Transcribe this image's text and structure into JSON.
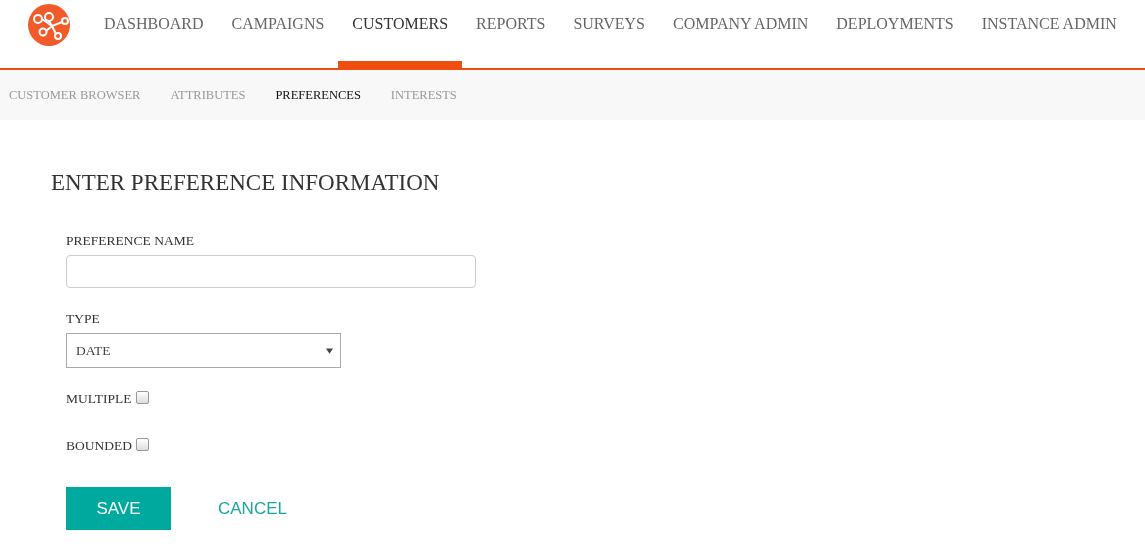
{
  "nav": [
    {
      "label": "DASHBOARD",
      "selected": false
    },
    {
      "label": "CAMPAIGNS",
      "selected": false
    },
    {
      "label": "CUSTOMERS",
      "selected": true
    },
    {
      "label": "REPORTS",
      "selected": false
    },
    {
      "label": "SURVEYS",
      "selected": false
    },
    {
      "label": "COMPANY ADMIN",
      "selected": false
    },
    {
      "label": "DEPLOYMENTS",
      "selected": false
    },
    {
      "label": "INSTANCE ADMIN",
      "selected": false
    }
  ],
  "subnav": [
    {
      "label": "CUSTOMER BROWSER",
      "selected": false
    },
    {
      "label": "ATTRIBUTES",
      "selected": false
    },
    {
      "label": "PREFERENCES",
      "selected": true
    },
    {
      "label": "INTERESTS",
      "selected": false
    }
  ],
  "form": {
    "title": "ENTER PREFERENCE INFORMATION",
    "name_label": "PREFERENCE NAME",
    "type_label": "TYPE",
    "type_value": "DATE",
    "checkboxes": [
      {
        "label": "MULTIPLE",
        "checked": false
      },
      {
        "label": "BOUNDED",
        "checked": false
      }
    ],
    "buttons": [
      {
        "label": "SAVE",
        "kind": "primary"
      },
      {
        "label": "CANCEL",
        "kind": "link"
      }
    ]
  }
}
